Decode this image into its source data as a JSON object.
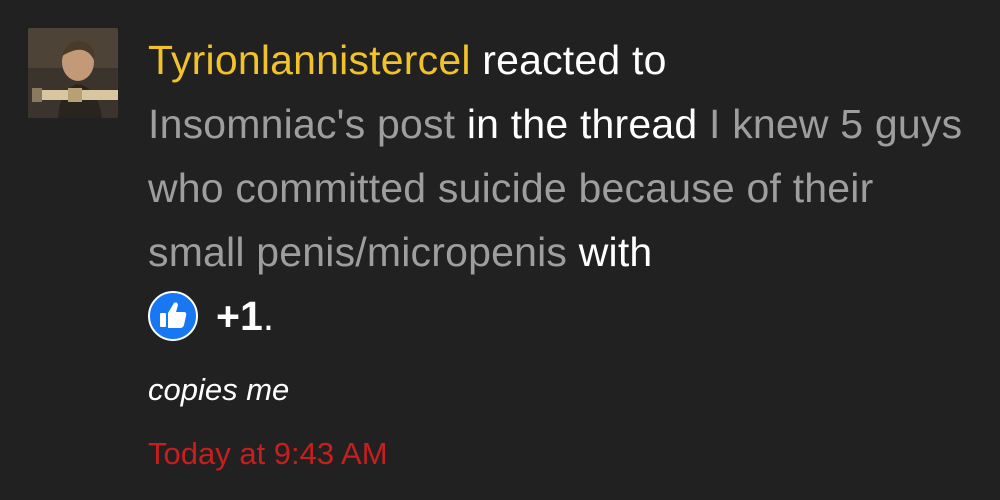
{
  "notification": {
    "avatar_icon": "user-avatar-portrait",
    "username": "Tyrionlannistercel",
    "reacted_text": "reacted to",
    "post_link": "Insomniac's post",
    "in_thread_text": "in the thread",
    "thread_title": "I knew 5 guys who committed suicide because of their small penis/micropenis",
    "with_text": "with",
    "reaction": {
      "icon": "like-icon",
      "count": "+1",
      "period": "."
    },
    "comment": "copies me",
    "timestamp": "Today at 9:43 AM"
  },
  "colors": {
    "background": "#212121",
    "username": "#f2c22a",
    "muted_link": "#9e9e9e",
    "text": "#ffffff",
    "timestamp": "#c81e1e",
    "like_blue": "#1877f2"
  }
}
